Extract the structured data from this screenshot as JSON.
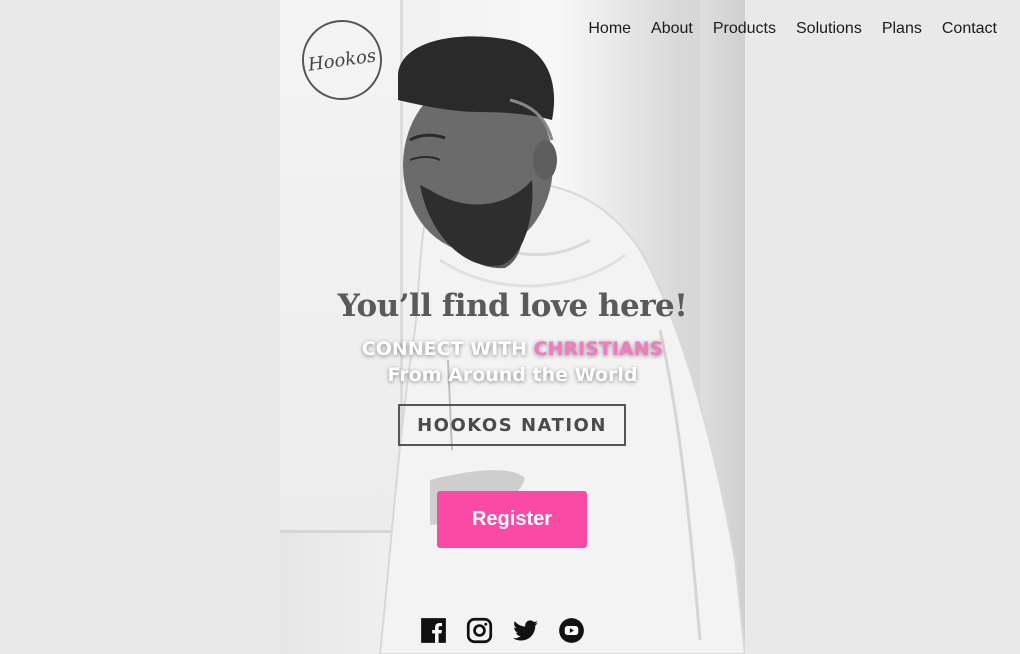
{
  "brand": {
    "logo_text": "Hookos"
  },
  "nav": {
    "items": [
      "Home",
      "About",
      "Products",
      "Solutions",
      "Plans",
      "Contact"
    ]
  },
  "hero": {
    "headline": "You’ll find love here!",
    "subtitle_prefix": "CONNECT WITH ",
    "subtitle_highlight": "CHRISTIANS",
    "subtitle_line2": "From Around the World",
    "badge": "HOOKOS NATION",
    "cta_label": "Register"
  },
  "social": {
    "icons": [
      "facebook-icon",
      "instagram-icon",
      "twitter-icon",
      "youtube-icon"
    ]
  },
  "colors": {
    "accent": "#fb4aa6",
    "highlight": "#f47ac0",
    "background": "#e9e9e9"
  }
}
